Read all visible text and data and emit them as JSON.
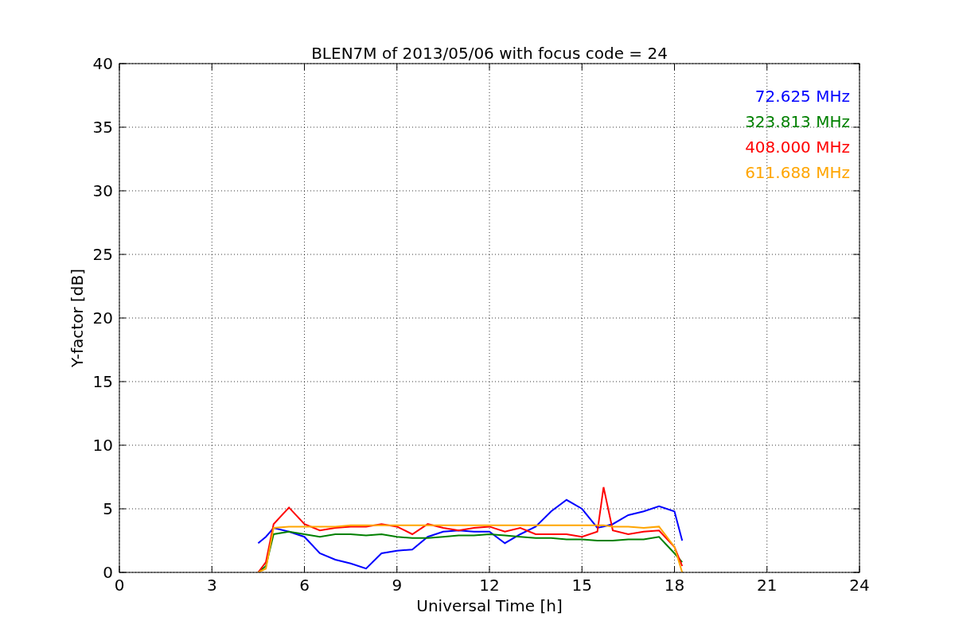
{
  "figure": {
    "chart_data": {
      "type": "line",
      "title": "BLEN7M of 2013/05/06 with focus code = 24",
      "xlabel": "Universal Time [h]",
      "ylabel": "Y-factor [dB]",
      "grid": true,
      "x": [
        4.5,
        4.75,
        5,
        5.5,
        6,
        6.5,
        7,
        7.5,
        8,
        8.5,
        9,
        9.5,
        10,
        10.5,
        11,
        11.5,
        12,
        12.5,
        13,
        13.5,
        14,
        14.5,
        15,
        15.5,
        15.7,
        16,
        16.5,
        17,
        17.5,
        18,
        18.25
      ],
      "series": [
        {
          "name": "72.625 MHz",
          "color": "#0000ff",
          "values": [
            2.3,
            2.8,
            3.5,
            3.2,
            2.8,
            1.5,
            1.0,
            0.7,
            0.3,
            1.5,
            1.7,
            1.8,
            2.8,
            3.2,
            3.3,
            3.2,
            3.2,
            2.3,
            3.0,
            3.6,
            4.8,
            5.7,
            5.0,
            3.5,
            3.6,
            3.8,
            4.5,
            4.8,
            5.2,
            4.8,
            2.5
          ]
        },
        {
          "name": "323.813 MHz",
          "color": "#008000",
          "values": [
            0,
            0.5,
            3.0,
            3.2,
            3.0,
            2.8,
            3.0,
            3.0,
            2.9,
            3.0,
            2.8,
            2.7,
            2.7,
            2.8,
            2.9,
            2.9,
            3.0,
            2.9,
            2.8,
            2.7,
            2.7,
            2.6,
            2.6,
            2.5,
            2.5,
            2.5,
            2.6,
            2.6,
            2.8,
            1.5,
            0.8
          ]
        },
        {
          "name": "408.000 MHz",
          "color": "#ff0000",
          "values": [
            0,
            0.8,
            3.8,
            5.1,
            3.8,
            3.3,
            3.5,
            3.6,
            3.6,
            3.8,
            3.6,
            3.0,
            3.8,
            3.5,
            3.3,
            3.5,
            3.6,
            3.2,
            3.5,
            3.0,
            3.0,
            3.0,
            2.8,
            3.2,
            6.7,
            3.3,
            3.0,
            3.2,
            3.3,
            2.0,
            0.5
          ]
        },
        {
          "name": "611.688 MHz",
          "color": "#ffa500",
          "values": [
            0,
            0.3,
            3.5,
            3.6,
            3.6,
            3.6,
            3.6,
            3.7,
            3.7,
            3.7,
            3.7,
            3.7,
            3.7,
            3.7,
            3.7,
            3.7,
            3.7,
            3.7,
            3.7,
            3.7,
            3.7,
            3.7,
            3.7,
            3.7,
            3.7,
            3.6,
            3.6,
            3.5,
            3.6,
            2.0,
            0
          ]
        }
      ],
      "xlim": [
        0,
        24
      ],
      "ylim": [
        0,
        40
      ],
      "xticks": [
        0,
        3,
        6,
        9,
        12,
        15,
        18,
        21,
        24
      ],
      "yticks": [
        0,
        5,
        10,
        15,
        20,
        25,
        30,
        35,
        40
      ]
    }
  }
}
